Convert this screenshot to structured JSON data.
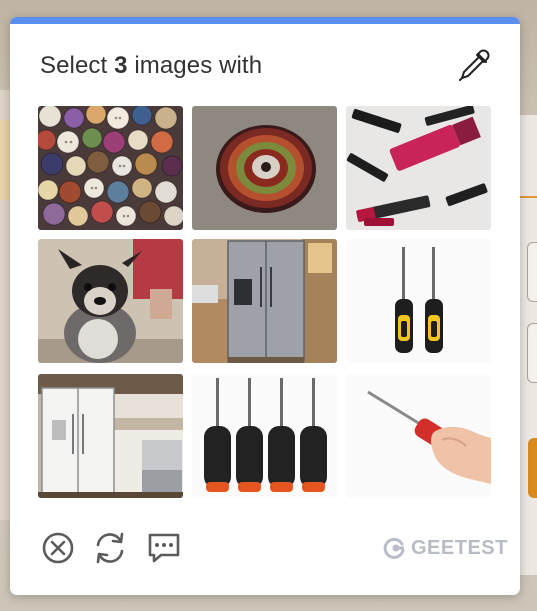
{
  "captcha": {
    "prompt_prefix": "Select",
    "prompt_count": "3",
    "prompt_suffix": "images with",
    "accent_color": "#5a8ff0",
    "images": [
      {
        "subject": "buttons",
        "icon": "buttons-image"
      },
      {
        "subject": "button",
        "icon": "button-image"
      },
      {
        "subject": "lipstick",
        "icon": "lipstick-image"
      },
      {
        "subject": "dog",
        "icon": "dog-image"
      },
      {
        "subject": "refrigerator",
        "icon": "refrigerator-image"
      },
      {
        "subject": "screwdrivers",
        "icon": "screwdrivers-image"
      },
      {
        "subject": "refrigerator",
        "icon": "fridge-kitchen-image"
      },
      {
        "subject": "screwdrivers",
        "icon": "screwdriver-set-image"
      },
      {
        "subject": "screwdriver",
        "icon": "hand-screwdriver-image"
      }
    ],
    "controls": {
      "close_icon": "close-icon",
      "refresh_icon": "refresh-icon",
      "feedback_icon": "feedback-icon"
    },
    "brand": {
      "text": "GEETEST",
      "color": "#b7bcc6"
    }
  }
}
